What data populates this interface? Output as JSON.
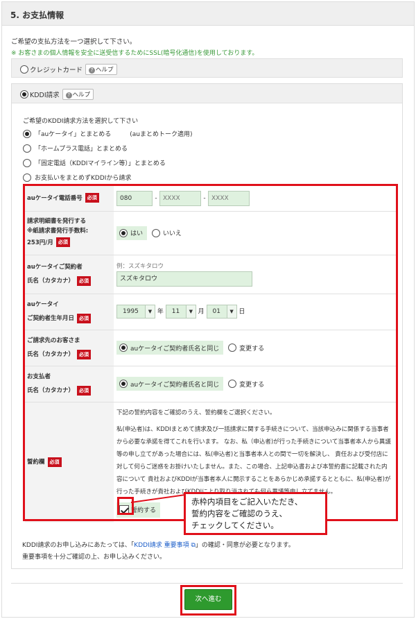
{
  "section": {
    "title": "5. お支払情報"
  },
  "intro": {
    "line1": "ご希望の支払方法を一つ選択して下さい。",
    "line2": "※ お客さまの個人情報を安全に送受信するためにSSL(暗号化通信)を使用しております。"
  },
  "methods": {
    "credit": {
      "label": "クレジットカード",
      "help": "ヘルプ",
      "selected": false
    },
    "kddi": {
      "label": "KDDI請求",
      "help": "ヘルプ",
      "selected": true
    }
  },
  "kddi_options": {
    "title": "ご希望のKDDI請求方法を選択して下さい",
    "items": [
      {
        "label": "「auケータイ」とまとめる　　　(auまとめトーク適用)",
        "selected": true
      },
      {
        "label": "「ホームプラス電話」とまとめる",
        "selected": false
      },
      {
        "label": "「固定電話（KDDIマイライン等）」とまとめる",
        "selected": false
      },
      {
        "label": "お支払いをまとめずKDDIから請求",
        "selected": false
      }
    ]
  },
  "required_label": "必須",
  "form": {
    "phone": {
      "label": "auケータイ電話番号",
      "p1": "080",
      "p2": "XXXX",
      "p3": "XXXX"
    },
    "statement": {
      "label1": "請求明細書を発行する",
      "label2": "※紙請求書発行手数料:",
      "label3": "253円/月",
      "yes": "はい",
      "no": "いいえ",
      "selected": "yes"
    },
    "contract_name": {
      "label1": "auケータイご契約者",
      "label2": "氏名（カタカナ）",
      "example": "例：スズキタロウ",
      "value": "スズキタロウ"
    },
    "birthdate": {
      "label1": "auケータイ",
      "label2": "ご契約者生年月日",
      "year": "1995",
      "year_unit": "年",
      "month": "11",
      "month_unit": "月",
      "day": "01",
      "day_unit": "日"
    },
    "billing_name": {
      "label1": "ご請求先のお客さま",
      "label2": "氏名（カタカナ）",
      "same": "auケータイご契約者氏名と同じ",
      "change": "変更する"
    },
    "payer_name": {
      "label1": "お支払者",
      "label2": "氏名（カタカナ）",
      "same": "auケータイご契約者氏名と同じ",
      "change": "変更する"
    },
    "pledge": {
      "label": "誓約欄",
      "intro": "下記の誓約内容をご確認のうえ、誓約欄をご選択ください。",
      "body": "私(申込者)は、KDDIまとめて請求及び一括請求に関する手続きについて、当該申込みに関係する当事者から必要な承諾を得てこれを行います。 なお、私（申込者)が行った手続きについて当事者本人から異議等の申し立てがあった場合には、私(申込者)と当事者本人との間で一切を解決し、 責任および受付店に 対して何らご迷惑をお掛けいたしません。また、この場合、上記申込書および本誓約書に記載された内容について 貴社およびKDDIが当事者本人に開示することをあらかじめ承諾するとともに、私(申込者)が行った手続きが貴社およびKDDIにより取り消されても何ら異議等申し立てません。",
      "agree": "誓約する",
      "checked": true
    }
  },
  "callout": {
    "line1": "赤枠内項目をご記入いただき、",
    "line2": "誓約内容をご確認のうえ、",
    "line3": "チェックしてください。"
  },
  "notice": {
    "prefix": "KDDI請求のお申し込みにあたっては、「",
    "link": "KDDI請求 重要事項",
    "suffix": "」の確認・同意が必要となります。",
    "line2": "重要事項を十分ご確認の上、お申し込みください。"
  },
  "next_button": "次へ進む",
  "colors": {
    "required": "#c8101c",
    "highlight": "#e0101a",
    "input_bg": "#dff1df",
    "button": "#2e9a2e",
    "note_green": "#3a9a3a",
    "link": "#1a5cc8"
  }
}
